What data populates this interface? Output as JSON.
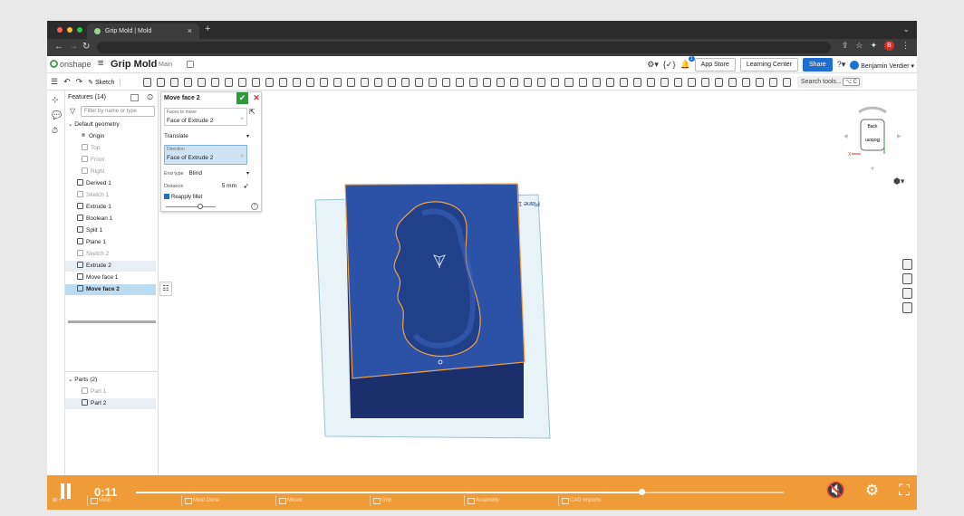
{
  "browser": {
    "tab_title": "Grip Mold | Mold",
    "new_tab": "+",
    "tab_close": "×",
    "tab_menu": "⌄",
    "profile_initial": "B"
  },
  "app": {
    "logo_text": "onshape",
    "menu_icon": "≡",
    "doc_title": "Grip Mold",
    "branch": "Main",
    "app_store": "App Store",
    "learning_center": "Learning Center",
    "share": "Share",
    "user_name": "Benjamin Verdier ▾",
    "notification_count": "1",
    "accent": "#1f6fd0"
  },
  "toolbar": {
    "sketch_label": "Sketch",
    "search_placeholder": "Search tools...",
    "search_shortcut": "⌥ C"
  },
  "feature_list": {
    "title": "Features (14)",
    "filter_placeholder": "Filter by name or type",
    "default_geometry": "Default geometry",
    "items": [
      {
        "label": "Origin",
        "kind": "origin"
      },
      {
        "label": "Top",
        "kind": "plane-dim"
      },
      {
        "label": "Front",
        "kind": "plane-dim"
      },
      {
        "label": "Right",
        "kind": "plane-dim"
      },
      {
        "label": "Derived 1",
        "kind": "feature"
      },
      {
        "label": "Sketch 1",
        "kind": "dim"
      },
      {
        "label": "Extrude 1",
        "kind": "feature"
      },
      {
        "label": "Boolean 1",
        "kind": "feature"
      },
      {
        "label": "Split 1",
        "kind": "feature"
      },
      {
        "label": "Plane 1",
        "kind": "feature"
      },
      {
        "label": "Sketch 2",
        "kind": "dim"
      },
      {
        "label": "Extrude 2",
        "kind": "highlighted"
      },
      {
        "label": "Move face 1",
        "kind": "feature"
      },
      {
        "label": "Move face 2",
        "kind": "selected"
      }
    ],
    "parts_header": "Parts (2)",
    "parts": [
      "Part 1",
      "Part 2"
    ]
  },
  "dialog": {
    "title": "Move face 2",
    "faces_caption": "Faces to move",
    "faces_value": "Face of Extrude 2",
    "move_type": "Translate",
    "direction_caption": "Direction",
    "direction_value": "Face of Extrude 2",
    "end_type_label": "End type",
    "end_type_value": "Blind",
    "distance_label": "Distance",
    "distance_value": "5 mm",
    "reapply_fillet": "Reapply fillet",
    "help": "?"
  },
  "viewport": {
    "plane_label": "Plane 1",
    "viewcube_back": "Back",
    "viewcube_bottom": "Bottom",
    "axis_x": "X",
    "body_color": "#1f4494",
    "edge_color": "#f0a040"
  },
  "video": {
    "time": "0:11",
    "progress": 0.78,
    "bar_color": "#ef9b37"
  },
  "doc_tabs": [
    "Mold",
    "Mold Done",
    "Mount",
    "Grip",
    "Assembly",
    "CAD Imports"
  ]
}
